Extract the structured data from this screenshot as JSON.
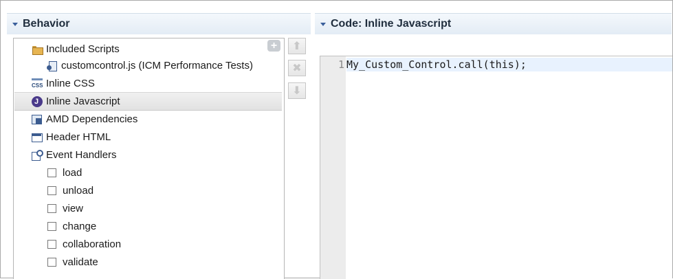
{
  "behavior": {
    "title": "Behavior",
    "tree": [
      {
        "label": "Included Scripts",
        "icon": "folder-icon",
        "level": 0
      },
      {
        "label": "customcontrol.js (ICM Performance Tests)",
        "icon": "script-file-icon",
        "level": 1
      },
      {
        "label": "Inline CSS",
        "icon": "css-icon",
        "level": 0
      },
      {
        "label": "Inline Javascript",
        "icon": "javascript-icon",
        "level": 0,
        "selected": true
      },
      {
        "label": "AMD Dependencies",
        "icon": "amd-dependencies-icon",
        "level": 0
      },
      {
        "label": "Header HTML",
        "icon": "header-html-icon",
        "level": 0
      },
      {
        "label": "Event Handlers",
        "icon": "event-handlers-icon",
        "level": 0
      }
    ],
    "events": [
      {
        "label": "load",
        "checked": false
      },
      {
        "label": "unload",
        "checked": false
      },
      {
        "label": "view",
        "checked": false
      },
      {
        "label": "change",
        "checked": false
      },
      {
        "label": "collaboration",
        "checked": false
      },
      {
        "label": "validate",
        "checked": false
      }
    ],
    "css_icon_text": "CSS",
    "add_icon_text": "+",
    "up_icon_text": "⬆",
    "remove_icon_text": "✖",
    "down_icon_text": "⬇"
  },
  "code": {
    "title": "Code: Inline Javascript",
    "lines": [
      {
        "number": "1",
        "text": "My_Custom_Control.call(this);"
      }
    ]
  }
}
